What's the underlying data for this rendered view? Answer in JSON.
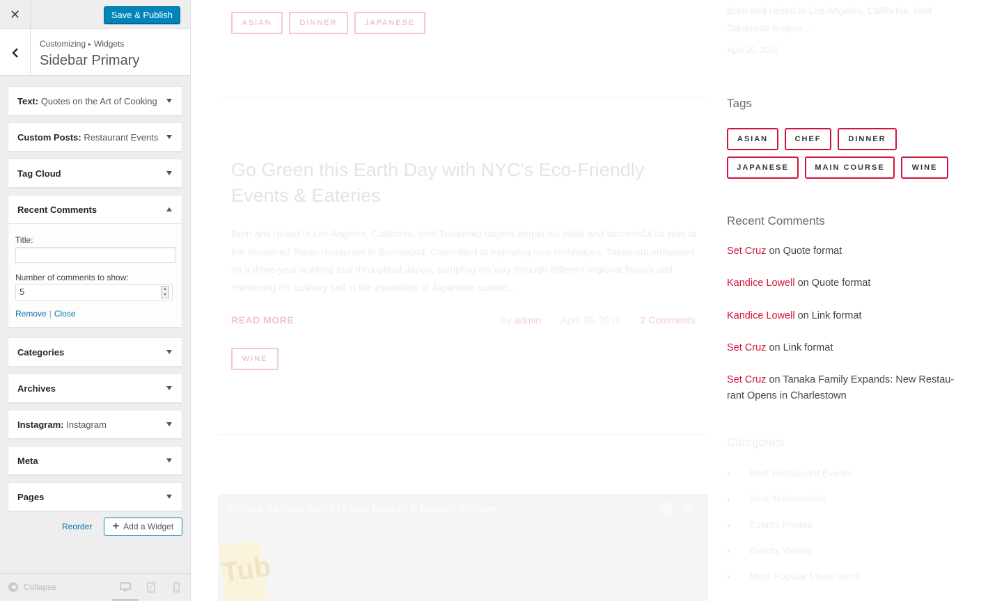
{
  "customizer": {
    "close_icon": "close-icon",
    "publish_label": "Save & Publish",
    "breadcrumb": {
      "root": "Customizing",
      "parent": "Widgets"
    },
    "section_title": "Sidebar Primary",
    "widgets": [
      {
        "type": "Text",
        "title": "Quotes on the Art of Cooking",
        "expanded": false
      },
      {
        "type": "Custom Posts",
        "title": "Restaurant Events",
        "expanded": false
      },
      {
        "type": "Tag Cloud",
        "title": "",
        "expanded": false
      },
      {
        "type": "Recent Comments",
        "title": "",
        "expanded": true
      },
      {
        "type": "Categories",
        "title": "",
        "expanded": false
      },
      {
        "type": "Archives",
        "title": "",
        "expanded": false
      },
      {
        "type": "Instagram",
        "title": "Instagram",
        "expanded": false
      },
      {
        "type": "Meta",
        "title": "",
        "expanded": false
      },
      {
        "type": "Pages",
        "title": "",
        "expanded": false
      }
    ],
    "recent_comments_form": {
      "title_label": "Title:",
      "title_value": "",
      "number_label": "Number of comments to show:",
      "number_value": "5",
      "remove_label": "Remove",
      "close_label": "Close"
    },
    "reorder_label": "Reorder",
    "add_widget_label": "Add a Widget",
    "collapse_label": "Collapse"
  },
  "preview": {
    "top_tags": [
      "ASIAN",
      "DINNER",
      "JAPANESE"
    ],
    "post": {
      "title": "Go Green this Earth Day with NYC's Eco-Friendly Events & Eateries",
      "excerpt": "Born and raised in Los Angeles, California, chef Takamoto Isojima began his initial and successful ca-reer at the renowned Takao restaurant in Brentwood. Committed to exploring new techniques, Takamoto embarked on a three-year working tour throughout Japan, sampling his way through different regional flavors and immersing his culinary self in the essentials of Japanese cuisine,...",
      "read_more": "READ MORE",
      "by": "By",
      "author": "admin",
      "date": "April 26, 2016",
      "comments": "2 Comments",
      "tags": [
        "WINE"
      ]
    },
    "video": {
      "title": "Simple Salmon Sushi | Food Busker & Haste's Kitchen",
      "logo_text": "Tub"
    },
    "sidebar": {
      "top_excerpt": "Born and raised in Los Angeles, California, chef Takamoto Isojima...",
      "top_date": "April 26, 2016",
      "tags_heading": "Tags",
      "tags": [
        "ASIAN",
        "CHEF",
        "DINNER",
        "JAPANESE",
        "MAIN COURSE",
        "WINE"
      ],
      "recent_comments_heading": "Recent Comments",
      "comments": [
        {
          "author": "Set Cruz",
          "on": "on",
          "post": "Quote format"
        },
        {
          "author": "Kandice Lowell",
          "on": "on",
          "post": "Quote format"
        },
        {
          "author": "Kandice Lowell",
          "on": "on",
          "post": "Link format"
        },
        {
          "author": "Set Cruz",
          "on": "on",
          "post": "Link format"
        },
        {
          "author": "Set Cruz",
          "on": "on",
          "post": "Tanaka Family Expands: New Restau-rant Opens in Charlestown"
        }
      ],
      "categories_heading": "Categories",
      "categories": [
        "Best Restaurant Events",
        "Best Testimonials",
        "Events Photos",
        "Events Videos",
        "Most Popular Menu Items"
      ]
    }
  },
  "colors": {
    "accent": "#d3123a",
    "wp_blue": "#0085ba",
    "link_blue": "#0073aa"
  }
}
